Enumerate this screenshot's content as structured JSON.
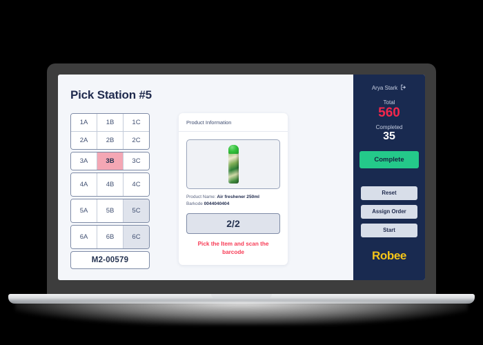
{
  "page": {
    "title": "Pick Station #5"
  },
  "bins": {
    "groups": [
      {
        "rows": [
          {
            "tall": false,
            "cells": [
              {
                "label": "1A",
                "state": "normal"
              },
              {
                "label": "1B",
                "state": "normal"
              },
              {
                "label": "1C",
                "state": "normal"
              }
            ]
          },
          {
            "tall": false,
            "cells": [
              {
                "label": "2A",
                "state": "normal"
              },
              {
                "label": "2B",
                "state": "normal"
              },
              {
                "label": "2C",
                "state": "normal"
              }
            ]
          }
        ]
      },
      {
        "rows": [
          {
            "tall": false,
            "cells": [
              {
                "label": "3A",
                "state": "normal"
              },
              {
                "label": "3B",
                "state": "active"
              },
              {
                "label": "3C",
                "state": "normal"
              }
            ]
          }
        ]
      },
      {
        "rows": [
          {
            "tall": true,
            "cells": [
              {
                "label": "4A",
                "state": "normal"
              },
              {
                "label": "4B",
                "state": "normal"
              },
              {
                "label": "4C",
                "state": "normal"
              }
            ]
          }
        ]
      },
      {
        "rows": [
          {
            "tall": true,
            "cells": [
              {
                "label": "5A",
                "state": "normal"
              },
              {
                "label": "5B",
                "state": "normal"
              },
              {
                "label": "5C",
                "state": "muted"
              }
            ]
          }
        ]
      },
      {
        "rows": [
          {
            "tall": true,
            "cells": [
              {
                "label": "6A",
                "state": "normal"
              },
              {
                "label": "6B",
                "state": "normal"
              },
              {
                "label": "6C",
                "state": "muted"
              }
            ]
          }
        ]
      }
    ],
    "tote_id": "M2-00579"
  },
  "product": {
    "card_title": "Product Information",
    "image_alt": "air-freshener-can",
    "name_label": "Product Name:",
    "name_value": "Air freshener 250ml",
    "barcode_label": "Barkode",
    "barcode_value": "0044040404",
    "count": "2/2",
    "instruction": "Pick the Item and scan the barcode"
  },
  "sidebar": {
    "user_name": "Arya Stark",
    "logout_icon": "logout-icon",
    "total_label": "Total",
    "total_value": "560",
    "completed_label": "Completed",
    "completed_value": "35",
    "complete_button": "Complete",
    "buttons": [
      {
        "label": "Reset"
      },
      {
        "label": "Assign Order"
      },
      {
        "label": "Start"
      }
    ],
    "brand": "Robee"
  },
  "colors": {
    "sidebar_bg": "#192a50",
    "accent_green": "#24c98a",
    "accent_red": "#f4274c",
    "warn_red": "#f73b55",
    "brand_yellow": "#f5c518",
    "active_bin": "#f4a7b4",
    "screen_bg": "#f4f6fa"
  }
}
